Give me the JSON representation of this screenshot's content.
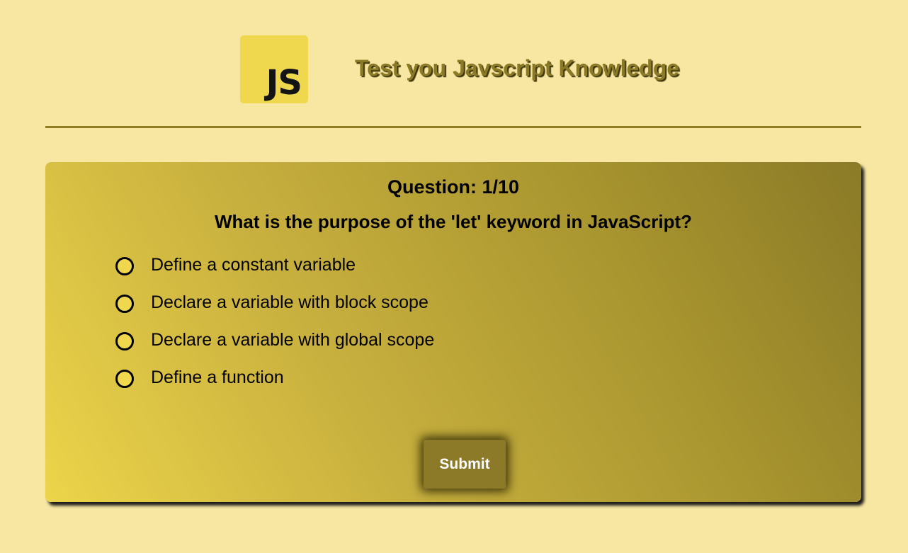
{
  "header": {
    "logo_text": "JS",
    "title": "Test you Javscript Knowledge"
  },
  "quiz": {
    "question_count": "Question: 1/10",
    "question": "What is the purpose of the 'let' keyword in JavaScript?",
    "options": [
      "Define a constant variable",
      "Declare a variable with block scope",
      "Declare a variable with global scope",
      "Define a function"
    ],
    "submit_label": "Submit"
  },
  "colors": {
    "page_background": "#f8e7a3",
    "logo_background": "#f0d84e",
    "accent": "#8c7a28"
  }
}
